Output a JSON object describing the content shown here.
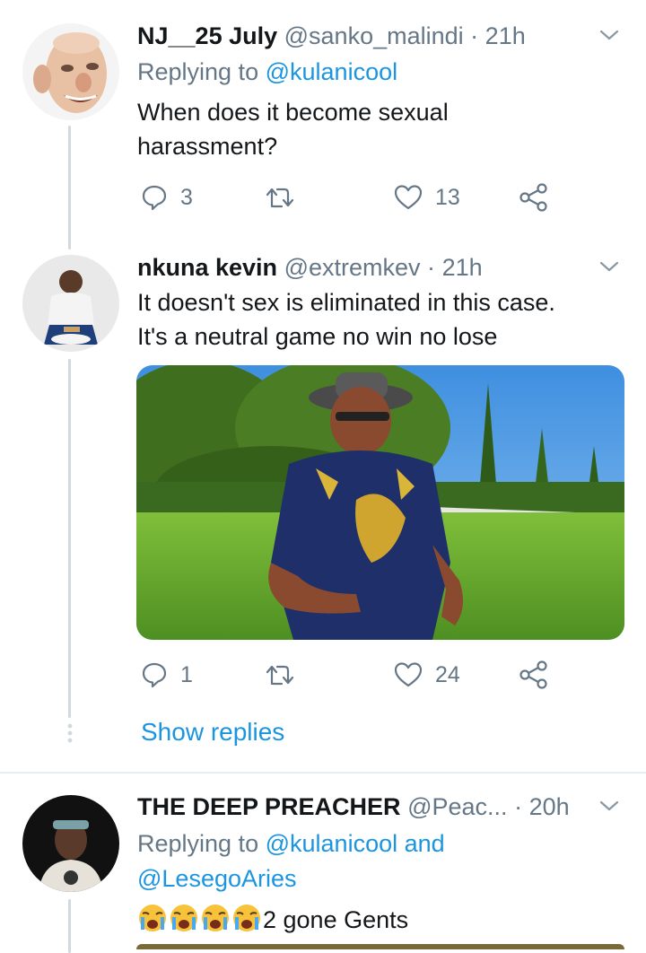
{
  "tweets": [
    {
      "name": "NJ__25 July",
      "handle": "@sanko_malindi",
      "separator": "·",
      "time": "21h",
      "replying_prefix": "Replying to",
      "replying_to": "@kulanicool",
      "text_line1": "When does it become sexual",
      "text_line2": "harassment?",
      "replies": "3",
      "likes": "13"
    },
    {
      "name": "nkuna kevin",
      "handle": "@extremkev",
      "separator": "·",
      "time": "21h",
      "text_line1": "It doesn't sex is eliminated in this case.",
      "text_line2": "It's a neutral game no win no lose",
      "replies": "1",
      "likes": "24",
      "show_replies": "Show replies"
    },
    {
      "name": "THE DEEP PREACHER",
      "handle": "@Peac...",
      "separator": "·",
      "time": "20h",
      "replying_prefix": "Replying to",
      "replying_to_1": "@kulanicool",
      "replying_and": "and",
      "replying_to_2": "@LesegoAries",
      "text": "2 gone Gents",
      "emoji": "crying-face"
    }
  ],
  "colors": {
    "text": "#14171a",
    "secondary": "#657786",
    "accent": "#1b95e0",
    "thread_line": "#cfd9de"
  },
  "icons": [
    "reply-icon",
    "retweet-icon",
    "like-icon",
    "share-icon",
    "chevron-down-icon"
  ]
}
